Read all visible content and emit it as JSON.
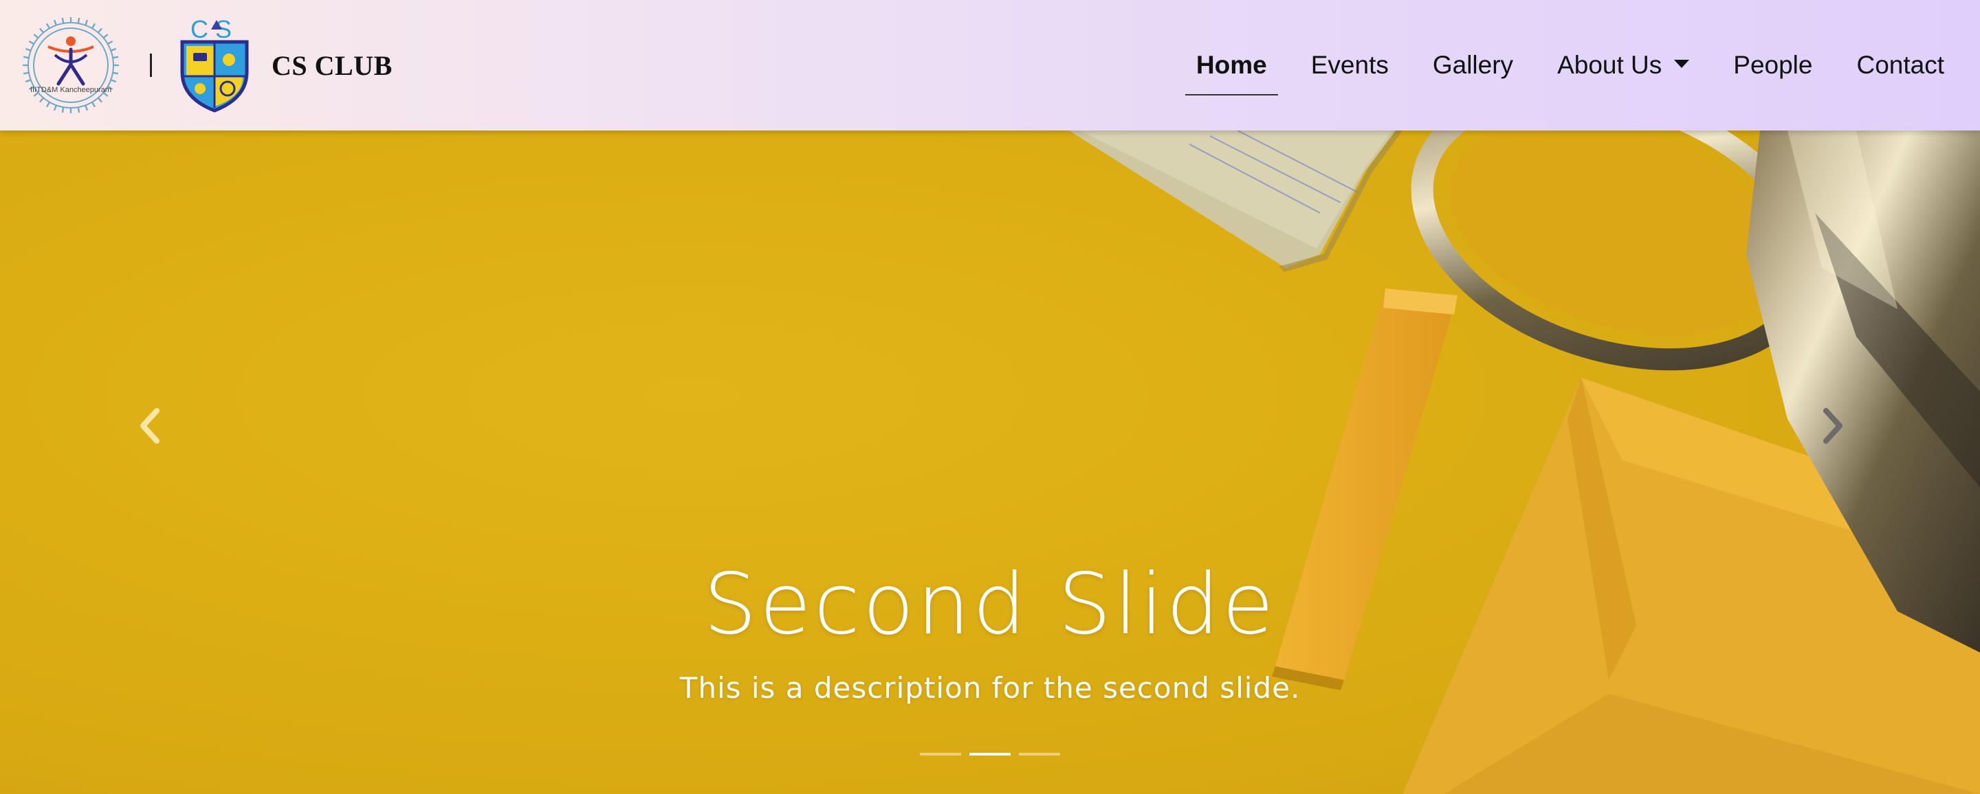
{
  "brand": {
    "name": "CS CLUB",
    "institute_logo_text": "IIITD&M Kancheepuram",
    "club_logo_text": "CS"
  },
  "nav": {
    "items": [
      {
        "label": "Home",
        "active": true
      },
      {
        "label": "Events",
        "active": false
      },
      {
        "label": "Gallery",
        "active": false
      },
      {
        "label": "About Us",
        "active": false,
        "dropdown": true
      },
      {
        "label": "People",
        "active": false
      },
      {
        "label": "Contact",
        "active": false
      }
    ]
  },
  "carousel": {
    "active_index": 1,
    "slide_count": 3,
    "caption": {
      "title": "Second Slide",
      "text": "This is a description for the second slide."
    },
    "prev_icon": "chevron-left-icon",
    "next_icon": "chevron-right-icon"
  },
  "colors": {
    "nav_gradient_start": "#fbebe8",
    "nav_gradient_end": "#dfd0fb",
    "slide_background": "#ddb015",
    "caption_text": "#ffffff"
  }
}
